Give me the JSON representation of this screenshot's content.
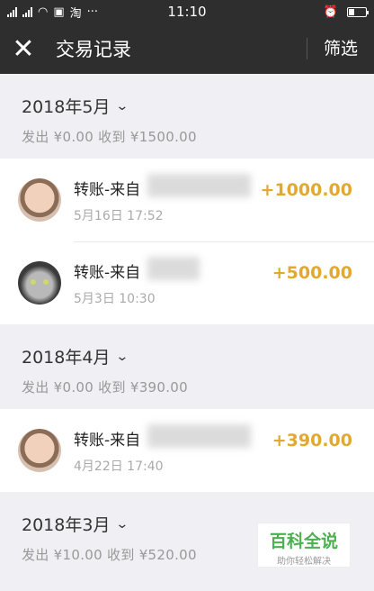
{
  "status_bar": {
    "time": "11:10",
    "carrier_icon": "淘",
    "more": "···",
    "icons": [
      "signal-icon",
      "wifi-icon",
      "message-icon",
      "alarm-icon",
      "battery-icon"
    ]
  },
  "nav": {
    "close_icon": "✕",
    "title": "交易记录",
    "filter_label": "筛选"
  },
  "chevron": "⌄",
  "months": [
    {
      "title": "2018年5月",
      "summary": "发出 ¥0.00 收到 ¥1500.00",
      "transactions": [
        {
          "title": "转账-来自",
          "date": "5月16日 17:52",
          "amount": "+1000.00",
          "avatar": "baby"
        },
        {
          "title": "转账-来自",
          "date": "5月3日 10:30",
          "amount": "+500.00",
          "avatar": "cat"
        }
      ]
    },
    {
      "title": "2018年4月",
      "summary": "发出 ¥0.00 收到 ¥390.00",
      "transactions": [
        {
          "title": "转账-来自",
          "date": "4月22日 17:40",
          "amount": "+390.00",
          "avatar": "baby"
        }
      ]
    },
    {
      "title": "2018年3月",
      "summary": "发出 ¥10.00 收到 ¥520.00",
      "transactions": []
    }
  ],
  "watermark": {
    "main": "百科全说",
    "sub": "助你轻松解决"
  },
  "colors": {
    "bar": "#2e2e2e",
    "amount": "#e2a930",
    "background": "#efeff4"
  }
}
